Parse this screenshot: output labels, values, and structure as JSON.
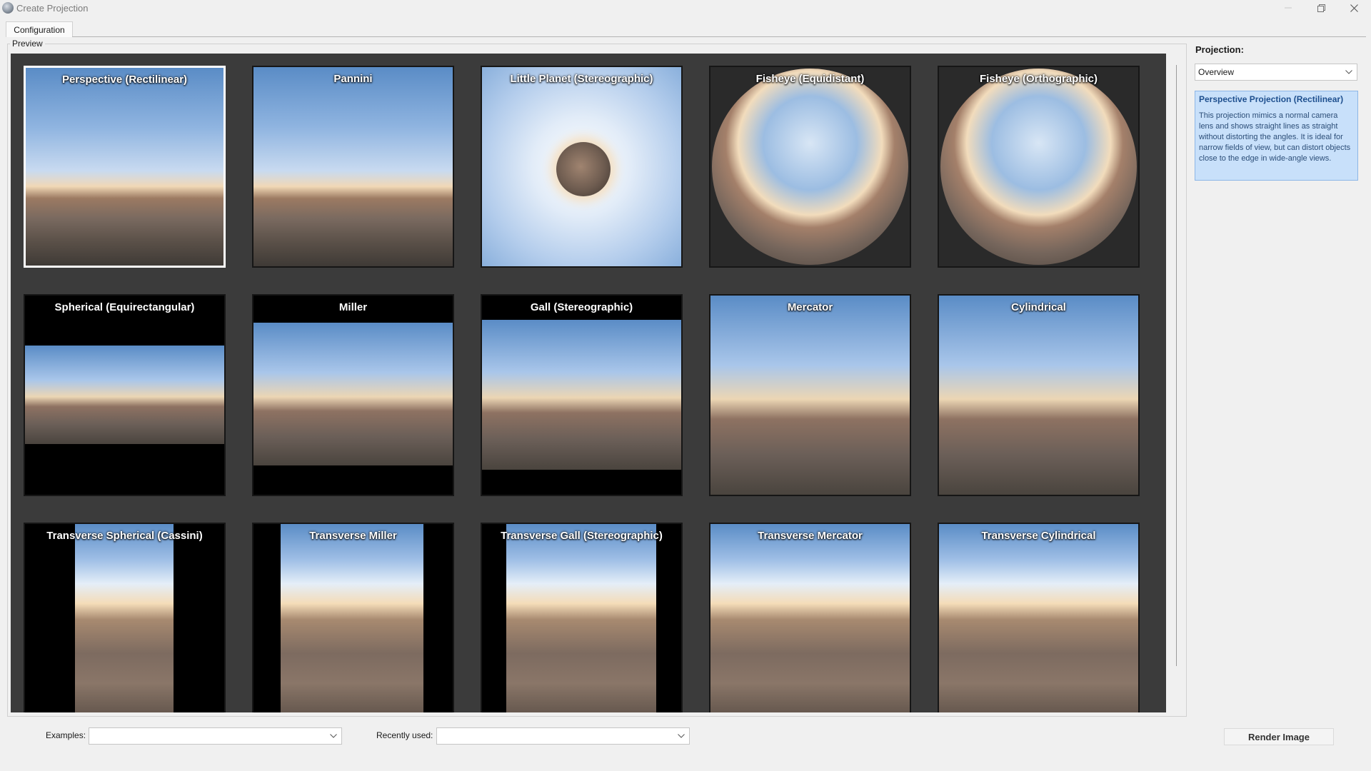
{
  "window": {
    "title": "Create Projection",
    "icon": "camera-lens-icon"
  },
  "tabs": [
    {
      "label": "Configuration",
      "active": true
    }
  ],
  "preview": {
    "label": "Preview",
    "items": [
      {
        "label": "Perspective (Rectilinear)",
        "selected": true
      },
      {
        "label": "Pannini"
      },
      {
        "label": "Little Planet (Stereographic)"
      },
      {
        "label": "Fisheye (Equidistant)"
      },
      {
        "label": "Fisheye (Orthographic)"
      },
      {
        "label": "Spherical (Equirectangular)"
      },
      {
        "label": "Miller"
      },
      {
        "label": "Gall (Stereographic)"
      },
      {
        "label": "Mercator"
      },
      {
        "label": "Cylindrical"
      },
      {
        "label": "Transverse Spherical (Cassini)"
      },
      {
        "label": "Transverse Miller"
      },
      {
        "label": "Transverse Gall (Stereographic)"
      },
      {
        "label": "Transverse Mercator"
      },
      {
        "label": "Transverse Cylindrical"
      }
    ]
  },
  "panel": {
    "projection_label": "Projection:",
    "projection_value": "Overview",
    "info_title": "Perspective Projection (Rectilinear)",
    "info_text": "This projection mimics a normal camera lens and shows straight lines as straight without distorting the angles. It is ideal for narrow fields of view, but can distort objects close to the edge in wide-angle views."
  },
  "bottom": {
    "examples_label": "Examples:",
    "examples_value": "",
    "recent_label": "Recently used:",
    "recent_value": "",
    "render_label": "Render Image"
  },
  "colors": {
    "canvas_bg": "#3b3b3b",
    "info_bg": "#c8e0fa",
    "info_title": "#1e4f8e",
    "selected_border": "#ffffff"
  }
}
